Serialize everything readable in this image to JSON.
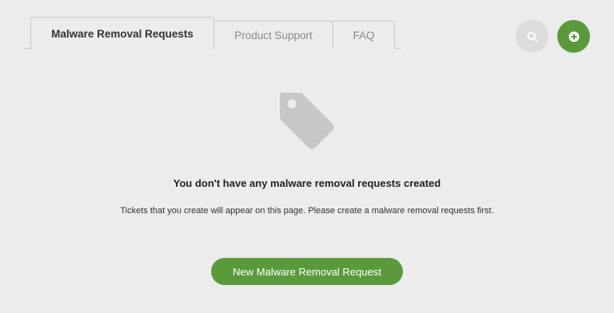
{
  "tabs": [
    {
      "label": "Malware Removal Requests",
      "active": true
    },
    {
      "label": "Product Support",
      "active": false
    },
    {
      "label": "FAQ",
      "active": false
    }
  ],
  "actions": {
    "search_icon": "search-icon",
    "add_icon": "plus-circle-icon"
  },
  "empty_state": {
    "icon": "tag-icon",
    "title": "You don't have any malware removal requests created",
    "description": "Tickets that you create will appear on this page. Please create a malware removal requests first.",
    "button_label": "New Malware Removal Request"
  },
  "colors": {
    "background": "#ececec",
    "accent_green": "#5a9a3d",
    "icon_gray": "#c8c8c8"
  }
}
